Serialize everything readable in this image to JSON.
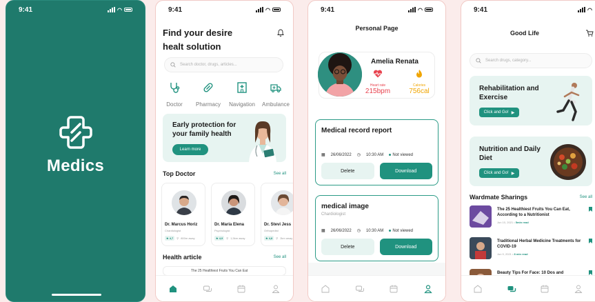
{
  "colors": {
    "brand": "#1f7a6c",
    "accent": "#20927f",
    "soft": "#e7f4f1",
    "alert": "#e8434f",
    "warm": "#f0a500"
  },
  "status": {
    "time": "9:41"
  },
  "splash": {
    "app_name": "Medics",
    "logo_icon": "medical-cross-icon"
  },
  "home": {
    "headline": "Find your desire healt solution",
    "search_placeholder": "Search doctor, drugs, articles...",
    "categories": [
      {
        "label": "Doctor",
        "icon": "stethoscope-icon"
      },
      {
        "label": "Pharmacy",
        "icon": "pill-icon"
      },
      {
        "label": "Navigation",
        "icon": "hospital-icon"
      },
      {
        "label": "Ambulance",
        "icon": "ambulance-icon"
      }
    ],
    "promo": {
      "title": "Early protection for your family health",
      "button": "Learn more"
    },
    "top_doctor": {
      "title": "Top Doctor",
      "see_all": "See all"
    },
    "doctors": [
      {
        "name": "Dr. Marcus Horiz",
        "specialty": "Chardiologist",
        "rating": "★ 4,7",
        "distance": "800m away"
      },
      {
        "name": "Dr. Maria Elena",
        "specialty": "Psychologist",
        "rating": "★ 4,9",
        "distance": "1,5km away"
      },
      {
        "name": "Dr. Stevi Jess",
        "specialty": "Orthopedist",
        "rating": "★ 4,8",
        "distance": "2km away"
      }
    ],
    "health_article": {
      "title": "Health article",
      "see_all": "See all",
      "peek": "The 25 Healthiest Fruits You Can Eat"
    }
  },
  "personal": {
    "title": "Personal Page",
    "name": "Amelia Renata",
    "heart": {
      "label": "Heart rate",
      "value": "215bpm"
    },
    "calories": {
      "label": "Calories",
      "value": "756cal"
    },
    "records": [
      {
        "title": "Medical record report",
        "subtitle": "",
        "date": "26/06/2022",
        "time": "10:30 AM",
        "status": "Not viewed",
        "delete": "Delete",
        "download": "Download"
      },
      {
        "title": "medical image",
        "subtitle": "Chardiologist",
        "date": "26/06/2022",
        "time": "10:30 AM",
        "status": "Not viewed",
        "delete": "Delete",
        "download": "Download"
      }
    ]
  },
  "goodlife": {
    "title": "Good Life",
    "search_placeholder": "Search drugs, category...",
    "banners": [
      {
        "title": "Rehabilitation and Exercise",
        "button": "Click and Go!"
      },
      {
        "title": "Nutrition and Daily Diet",
        "button": "Click and Go!"
      }
    ],
    "sharings": {
      "title": "Wardmate Sharings",
      "see_all": "See all"
    },
    "articles": [
      {
        "title": "The 25 Healthiest Fruits You Can Eat, According to a Nutritionist",
        "date": "Jun 10, 2021 • ",
        "read": "5min read"
      },
      {
        "title": "Traditional Herbal Medicine Treatments for COVID-19",
        "date": "Jun 9, 2021 • ",
        "read": "8 min read"
      },
      {
        "title": "Beauty Tips For Face: 10 Dos and",
        "date": "",
        "read": ""
      }
    ]
  }
}
